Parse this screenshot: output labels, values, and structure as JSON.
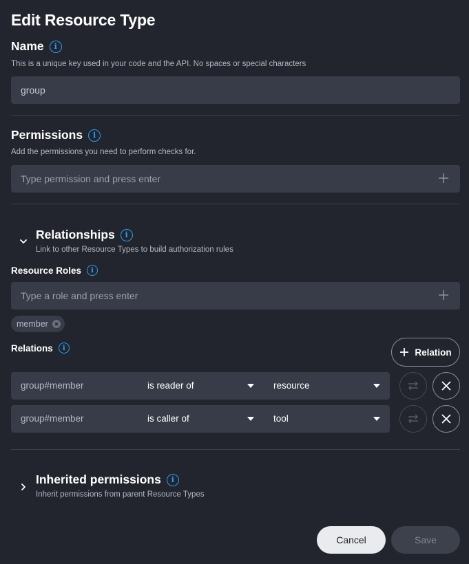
{
  "page_title": "Edit Resource Type",
  "name": {
    "label": "Name",
    "description": "This is a unique key used in your code and the API. No spaces or special characters",
    "value": "group"
  },
  "permissions": {
    "label": "Permissions",
    "description": "Add the permissions you need to perform checks for.",
    "placeholder": "Type permission and press enter"
  },
  "relationships": {
    "label": "Relationships",
    "description": "Link to other Resource Types to build authorization rules",
    "roles": {
      "label": "Resource Roles",
      "placeholder": "Type a role and press enter",
      "chips": [
        "member"
      ]
    },
    "relations": {
      "label": "Relations",
      "add_button": "Relation",
      "rows": [
        {
          "subject": "group#member",
          "relation": "is reader of",
          "object": "resource"
        },
        {
          "subject": "group#member",
          "relation": "is caller of",
          "object": "tool"
        }
      ]
    }
  },
  "inherited": {
    "label": "Inherited permissions",
    "description": "Inherit permissions from parent Resource Types"
  },
  "actions": {
    "cancel": "Cancel",
    "save": "Save"
  },
  "colors": {
    "background": "#22252d",
    "field": "#383c48",
    "info_accent": "#2a9df4"
  }
}
